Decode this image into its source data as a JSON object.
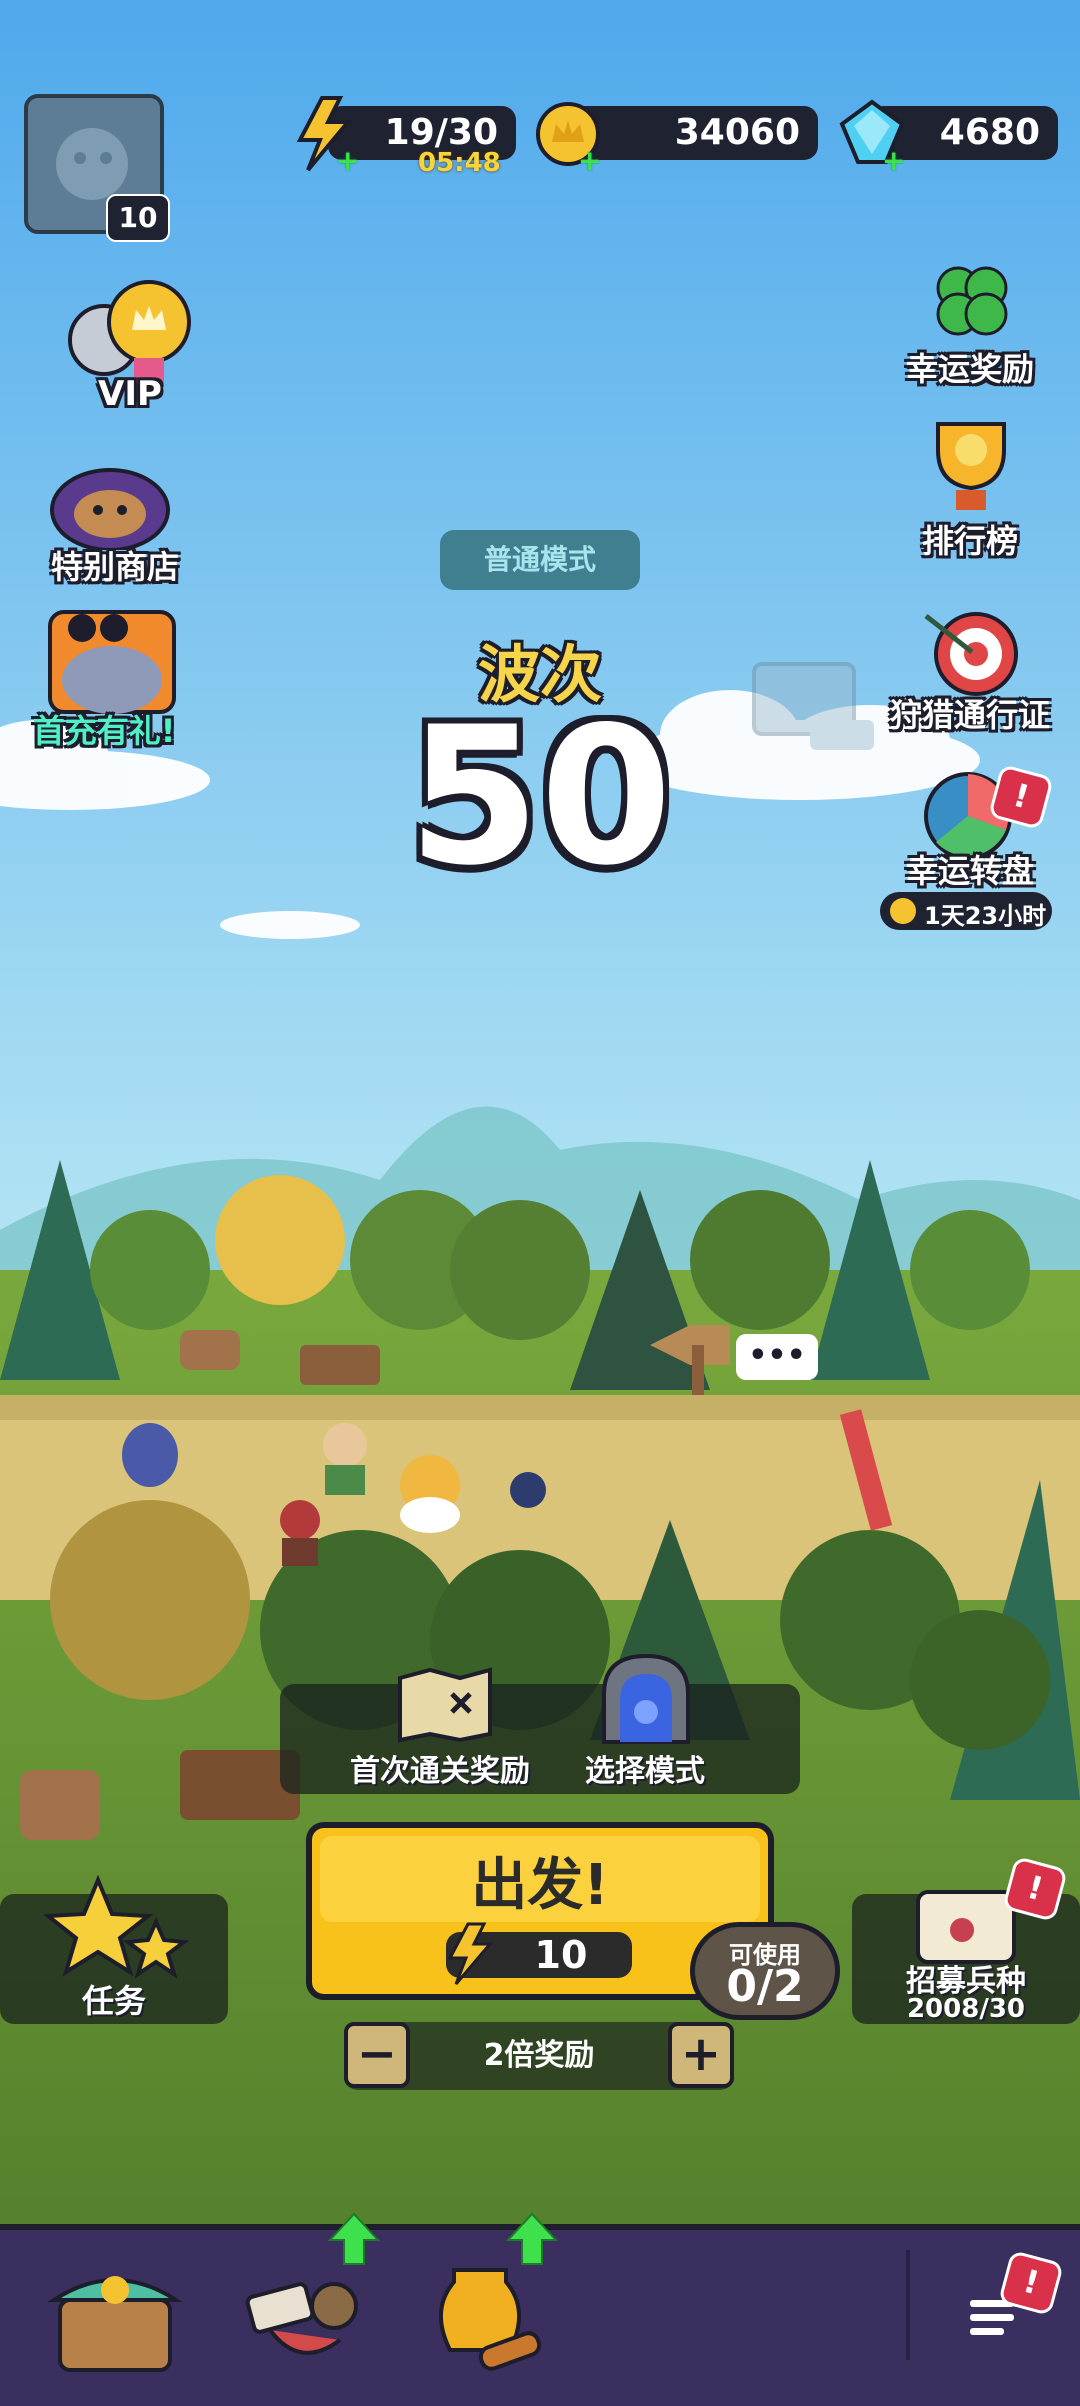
{
  "hud": {
    "level": "10",
    "energy": "19/30",
    "energy_timer": "05:48",
    "coins": "34060",
    "gems": "4680"
  },
  "left_menu": {
    "vip": "VIP",
    "special_shop": "特别商店",
    "first_recharge": "首充有礼!"
  },
  "right_menu": {
    "lucky_reward": "幸运奖励",
    "leaderboard": "排行榜",
    "hunting_pass": "狩猎通行证",
    "lucky_wheel": "幸运转盘",
    "lucky_wheel_timer": "1天23小时",
    "alert": "!"
  },
  "stage": {
    "mode": "普通模式",
    "wave_label": "波次",
    "wave_number": "50"
  },
  "chat_bubble": "•••",
  "actions": {
    "first_clear_reward": "首次通关奖励",
    "select_mode": "选择模式",
    "start": "出发!",
    "start_cost": "10",
    "available_label": "可使用",
    "available_count": "0/2",
    "double_reward": "2倍奖励",
    "minus": "−",
    "plus": "+",
    "tasks": "任务",
    "recruit": "招募兵种",
    "recruit_count": "2008/30"
  },
  "colors": {
    "sky_top": "#4fa9ec",
    "sky_bottom": "#b7e6f4",
    "grass": "#6c9a38",
    "road": "#d9c47a",
    "start_button": "#f8c21a",
    "nav_bg": "#3a2f5e",
    "accent_green": "#3ee04b",
    "alert_red": "#d9314a"
  }
}
